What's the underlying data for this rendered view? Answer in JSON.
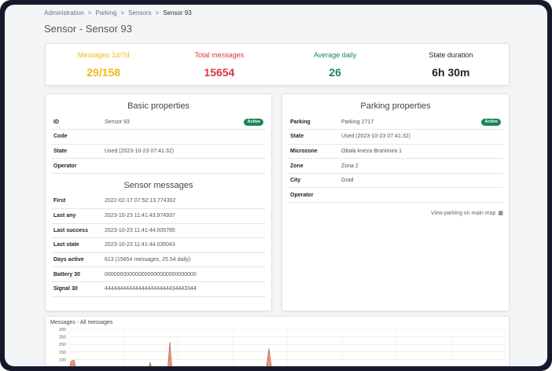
{
  "breadcrumb": {
    "items": [
      "Administration",
      "Parking",
      "Sensors"
    ],
    "current": "Sensor 93",
    "separator": ">"
  },
  "page_title": "Sensor - Sensor 93",
  "stats": [
    {
      "label": "Messages 1d/7d",
      "value": "29/158",
      "color": "#f4b81c"
    },
    {
      "label": "Total messages",
      "value": "15654",
      "color": "#dc3545"
    },
    {
      "label": "Average daily",
      "value": "26",
      "color": "#198754"
    },
    {
      "label": "State duration",
      "value": "6h 30m",
      "color": "#212529"
    }
  ],
  "basic": {
    "title": "Basic properties",
    "rows": [
      {
        "key": "ID",
        "value": "Sensor 93",
        "badge": "Active"
      },
      {
        "key": "Code",
        "value": ""
      },
      {
        "key": "State",
        "value": "Used (2023-10-23 07:41:32)"
      },
      {
        "key": "Operator",
        "value": ""
      }
    ]
  },
  "messages": {
    "title": "Sensor messages",
    "rows": [
      {
        "key": "First",
        "value": "2022-02-17 07:52:13.774302"
      },
      {
        "key": "Last any",
        "value": "2023-10-23 11:41:43.974937"
      },
      {
        "key": "Last success",
        "value": "2023-10-23 11:41:44.005785"
      },
      {
        "key": "Last state",
        "value": "2023-10-23 11:41:44.035043"
      },
      {
        "key": "Days active",
        "value": "613 (15654 messages, 25.54 daily)"
      },
      {
        "key": "Battery 30",
        "value": "000000000000000000000000000000"
      },
      {
        "key": "Signal 30",
        "value": "444444444444444444444434443344"
      }
    ]
  },
  "parking": {
    "title": "Parking properties",
    "rows": [
      {
        "key": "Parking",
        "value": "Parking 2717",
        "badge": "Active"
      },
      {
        "key": "State",
        "value": "Used (2023-10-23 07:41:32)"
      },
      {
        "key": "Microzone",
        "value": "Obala kneza Branimira 1"
      },
      {
        "key": "Zone",
        "value": "Zona 2"
      },
      {
        "key": "City",
        "value": "Grad"
      },
      {
        "key": "Operator",
        "value": ""
      }
    ],
    "map_link": "View parking on main map",
    "map_icon": "map-icon"
  },
  "chart_data": {
    "type": "area",
    "title": "Messages - All messages",
    "ylim": [
      0,
      300
    ],
    "yticks": [
      "300",
      "250",
      "200",
      "150",
      "100"
    ],
    "color": "#e9967a",
    "stroke": "#b5533c"
  }
}
